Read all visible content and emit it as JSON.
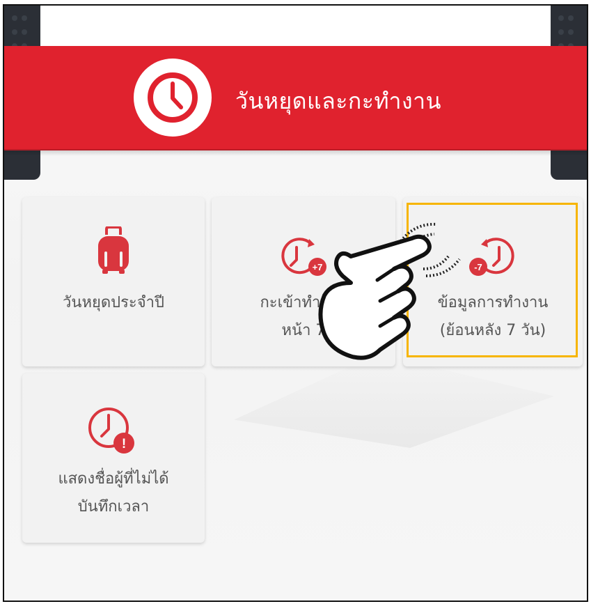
{
  "header": {
    "title": "วันหยุดและกะทำงาน"
  },
  "menu": [
    {
      "id": "annual-holidays",
      "label_lines": [
        "วันหยุดประจำปี"
      ]
    },
    {
      "id": "upcoming-shift",
      "label_lines": [
        "กะเข้าทำงาน",
        "หน้า 7"
      ],
      "badge": "+7"
    },
    {
      "id": "work-history",
      "label_lines": [
        "ข้อมูลการทำงาน",
        "(ย้อนหลัง 7 วัน)"
      ],
      "badge": "-7",
      "highlighted": true
    },
    {
      "id": "missing-time-records",
      "label_lines": [
        "แสดงชื่อผู้ที่ไม่ได้",
        "บันทึกเวลา"
      ],
      "badge": "!"
    }
  ],
  "colors": {
    "brand_red": "#e0222e",
    "icon_red": "#d9363e",
    "highlight": "#f7b500"
  },
  "icons": {
    "header": "clock-icon",
    "annual-holidays": "luggage-icon",
    "upcoming-shift": "clock-forward-icon",
    "work-history": "clock-backward-icon",
    "missing-time-records": "clock-alert-icon",
    "overlay": "tap-hand-icon"
  }
}
